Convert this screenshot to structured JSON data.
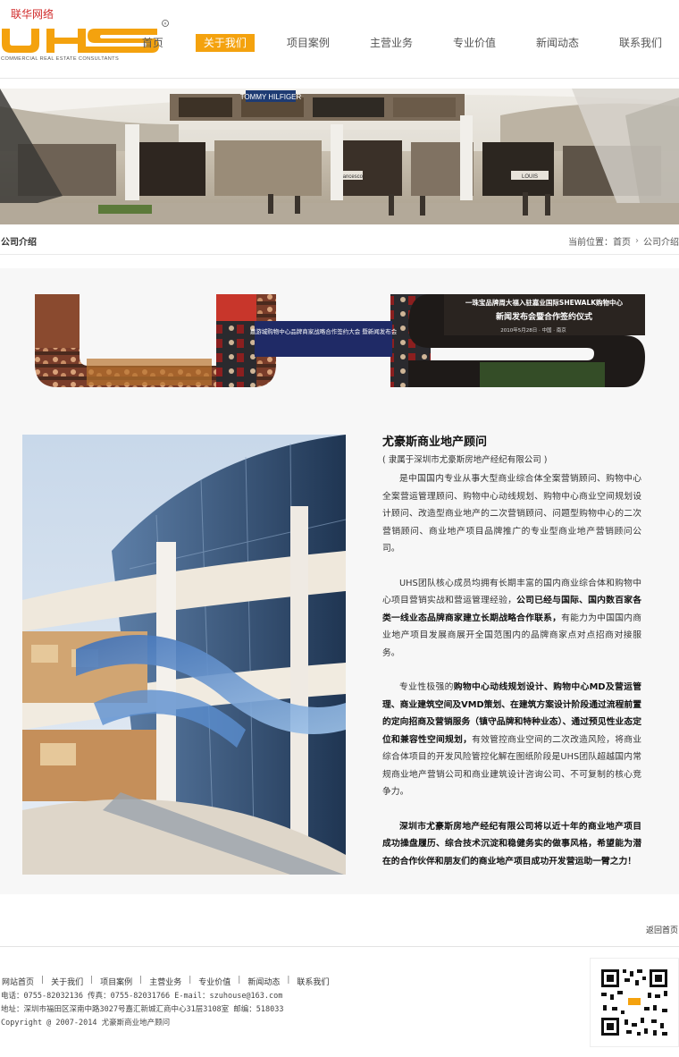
{
  "header": {
    "site_name": "联华网络",
    "logo_text": "UHS",
    "logo_tagline": "COMMERCIAL REAL ESTATE CONSULTANTS",
    "logo_mark": "R",
    "brand_color": "#f4a20e"
  },
  "nav": {
    "items": [
      {
        "label": "首页"
      },
      {
        "label": "关于我们",
        "active": true
      },
      {
        "label": "项目案例"
      },
      {
        "label": "主营业务"
      },
      {
        "label": "专业价值"
      },
      {
        "label": "新闻动态"
      },
      {
        "label": "联系我们"
      }
    ]
  },
  "banner": {
    "store_signs": [
      "TOMMY HILFIGER",
      "Francesco",
      "LOUIS"
    ]
  },
  "section": {
    "title": "公司介绍",
    "crumb_prefix": "当前位置：",
    "crumb_home": "首页",
    "crumb_current": "公司介绍"
  },
  "collage": {
    "captions": [
      "嘉游城购物中心品牌商家战略合作签约大会 暨新闻发布会",
      "一珠宝品牌周大福入驻嘉业国际SHEWALK购物中心",
      "新闻发布会暨合作签约仪式",
      "2010年5月28日 · 中国 · 南京"
    ]
  },
  "intro": {
    "title": "尤豪斯商业地产顾问",
    "subtitle": "( 隶属于深圳市尤豪斯房地产经纪有限公司 )",
    "p1": "是中国国内专业从事大型商业综合体全案营销顾问、购物中心全案营运管理顾问、购物中心动线规划、购物中心商业空间规划设计顾问、改造型商业地产的二次营销顾问、问题型购物中心的二次营销顾问、商业地产项目品牌推广的专业型商业地产营销顾问公司。",
    "p2_a": "UHS团队核心成员均拥有长期丰富的国内商业综合体和购物中心项目营销实战和营运管理经验，",
    "p2_b": "公司已经与国际、国内数百家各类一线业态品牌商家建立长期战略合作联系，",
    "p2_c": "有能力为中国国内商业地产项目发展商展开全国范围内的品牌商家点对点招商对接服务。",
    "p3_a": "专业性极强的",
    "p3_b": "购物中心动线规划设计、购物中心MD及营运管理、商业建筑空间及VMD策划、在建筑方案设计阶段通过流程前置的定向招商及营销服务（镇守品牌和特种业态）、通过预见性业态定位和兼容性空间规划，",
    "p3_c": "有效管控商业空间的二次改造风险，将商业综合体项目的开发风险管控化解在图纸阶段是UHS团队超越国内常规商业地产营销公司和商业建筑设计咨询公司、不可复制的核心竞争力。",
    "p4": "深圳市尤豪斯房地产经纪有限公司将以近十年的商业地产项目成功操盘履历、综合技术沉淀和稳健务实的做事风格，希望能为潜在的合作伙伴和朋友们的商业地产项目成功开发营运助一臂之力！"
  },
  "back_home": "返回首页",
  "footer": {
    "links": [
      "网站首页",
      "关于我们",
      "项目案例",
      "主营业务",
      "专业价值",
      "新闻动态",
      "联系我们"
    ],
    "separator": "|",
    "contact": "电话：0755-82032136 传真：0755-82031766 E-mail：szuhouse@163.com",
    "address": "地址：深圳市福田区深南中路3027号嘉汇新城汇商中心31层3108室 邮编：518033",
    "copyright": "Copyright @ 2007-2014 尤豪斯商业地产顾问"
  }
}
